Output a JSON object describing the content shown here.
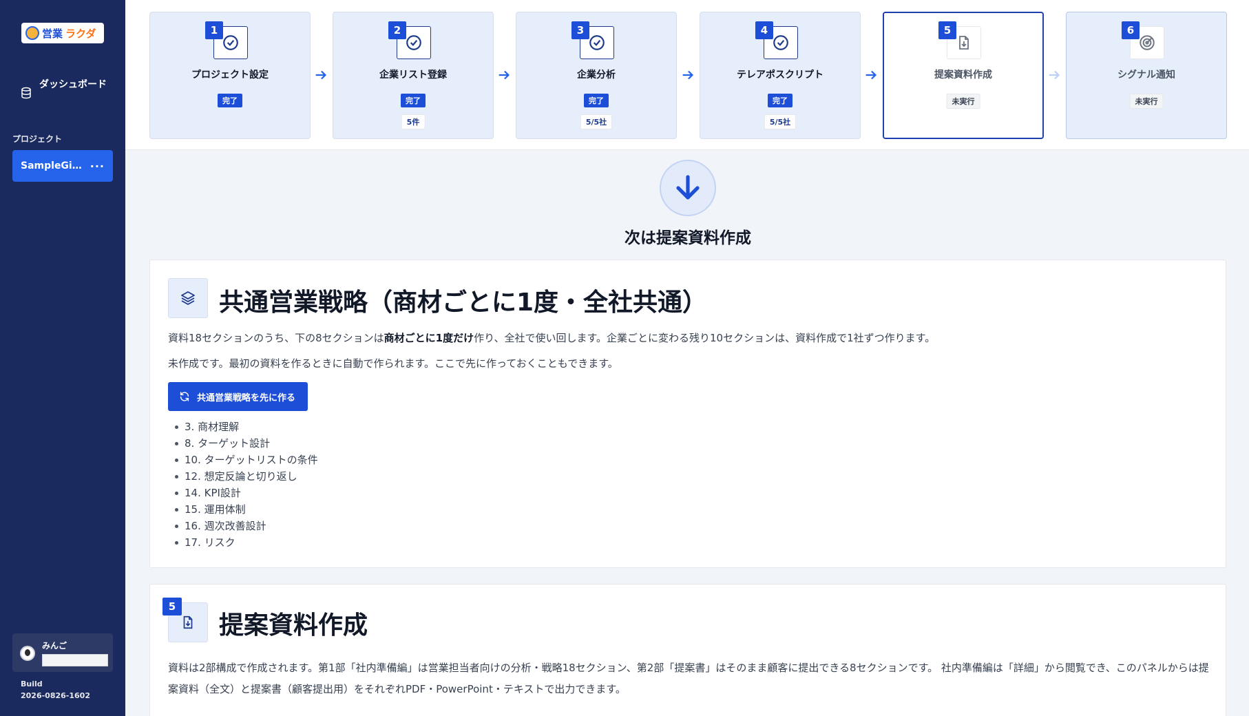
{
  "sidebar": {
    "logo_a": "営業",
    "logo_b": "ラクダ",
    "dashboard_label": "ダッシュボード",
    "projects_label": "プロジェクト",
    "project_name": "SampleGi…",
    "project_more": "···",
    "user_name": "みんご",
    "build_label": "Build",
    "build_version": "2026-0826-1602"
  },
  "steps": [
    {
      "num": "1",
      "title": "プロジェクト設定",
      "status": "完了",
      "count": ""
    },
    {
      "num": "2",
      "title": "企業リスト登録",
      "status": "完了",
      "count": "5件"
    },
    {
      "num": "3",
      "title": "企業分析",
      "status": "完了",
      "count": "5/5社"
    },
    {
      "num": "4",
      "title": "テレアポスクリプト",
      "status": "完了",
      "count": "5/5社"
    },
    {
      "num": "5",
      "title": "提案資料作成",
      "status": "未実行",
      "count": ""
    },
    {
      "num": "6",
      "title": "シグナル通知",
      "status": "未実行",
      "count": ""
    }
  ],
  "next": {
    "text": "次は提案資料作成"
  },
  "strategy": {
    "title": "共通営業戦略（商材ごとに1度・全社共通）",
    "desc1_pre": "資料18セクションのうち、下の8セクションは",
    "desc1_bold": "商材ごとに1度だけ",
    "desc1_post": "作り、全社で使い回します。企業ごとに変わる残り10セクションは、資料作成で1社ずつ作ります。",
    "desc2": "未作成です。最初の資料を作るときに自動で作られます。ここで先に作っておくこともできます。",
    "button_label": "共通営業戦略を先に作る",
    "sections": [
      "3. 商材理解",
      "8. ターゲット設計",
      "10. ターゲットリストの条件",
      "12. 想定反論と切り返し",
      "14. KPI設計",
      "15. 運用体制",
      "16. 週次改善設計",
      "17. リスク"
    ]
  },
  "proposal": {
    "num": "5",
    "title": "提案資料作成",
    "desc": "資料は2部構成で作成されます。第1部「社内準備編」は営業担当者向けの分析・戦略18セクション、第2部「提案書」はそのまま顧客に提出できる8セクションです。 社内準備編は「詳細」から閲覧でき、このパネルからは提案資料（全文）と提案書（顧客提出用）をそれぞれPDF・PowerPoint・テキストで出力できます。"
  },
  "colors": {
    "sidebar": "#1b2a5e",
    "accent": "#1d4ed8",
    "step_bg": "#e6edfb"
  },
  "icons": [
    "database-icon",
    "check-icon",
    "file-download-icon",
    "radar-icon",
    "arrow-right-icon",
    "arrow-down-icon",
    "layers-icon",
    "refresh-icon"
  ]
}
